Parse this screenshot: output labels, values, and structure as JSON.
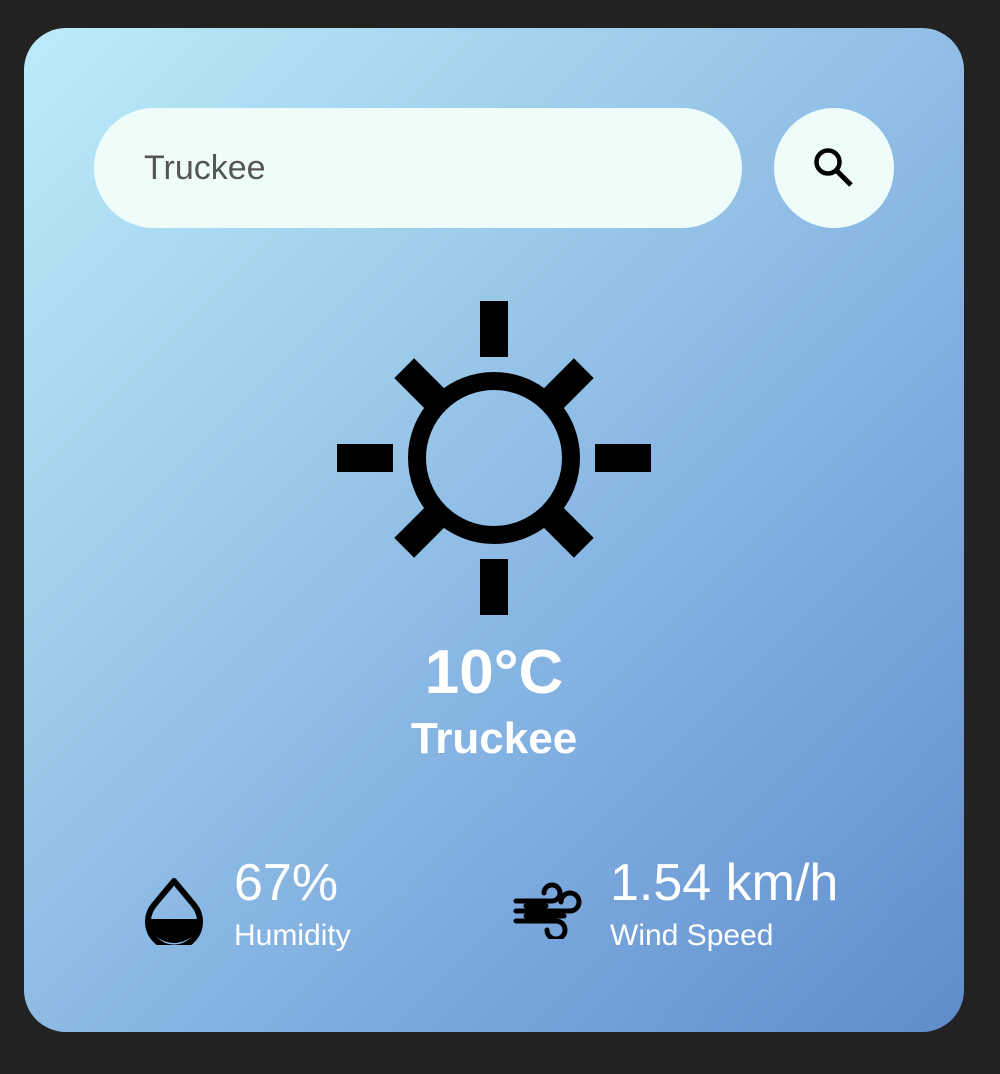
{
  "search": {
    "value": "Truckee",
    "button_icon": "search-icon"
  },
  "weather": {
    "icon": "sun-icon",
    "temperature": "10°C",
    "city": "Truckee"
  },
  "humidity": {
    "icon": "water-drop-icon",
    "value": "67%",
    "label": "Humidity"
  },
  "wind": {
    "icon": "wind-icon",
    "value": "1.54 km/h",
    "label": "Wind Speed"
  },
  "colors": {
    "page_background": "#222222",
    "card_gradient_start": "#bcecfa",
    "card_gradient_end": "#5f8ccc",
    "input_background": "#eefdfa",
    "text": "#ffffff"
  }
}
